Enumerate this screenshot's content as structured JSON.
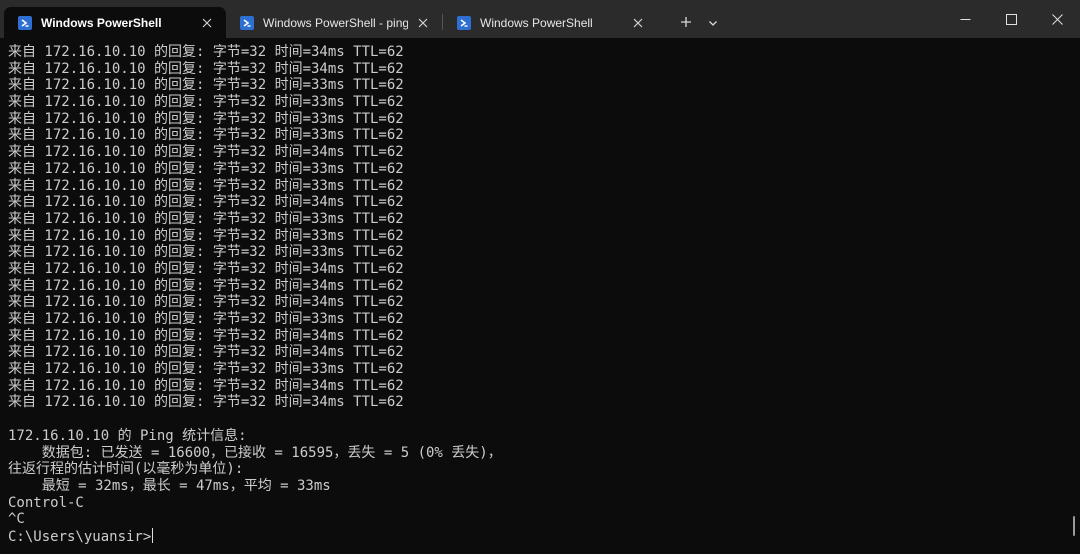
{
  "tabs": [
    {
      "title": "Windows PowerShell",
      "active": true
    },
    {
      "title": "Windows PowerShell - ping  ikt",
      "active": false
    },
    {
      "title": "Windows PowerShell",
      "active": false
    }
  ],
  "icons": {
    "tab_icon": "powershell-icon",
    "tab_close": "close-icon",
    "new_tab": "plus-icon",
    "dropdown": "chevron-down-icon",
    "minimize": "minimize-icon",
    "maximize": "maximize-icon",
    "close": "close-icon"
  },
  "colors": {
    "titlebar": "#2b2b2b",
    "terminal_bg": "#0c0c0c",
    "terminal_fg": "#cccccc",
    "powershell_icon": "#2d6fd3"
  },
  "terminal": {
    "lines": [
      "来自 172.16.10.10 的回复: 字节=32 时间=34ms TTL=62",
      "来自 172.16.10.10 的回复: 字节=32 时间=34ms TTL=62",
      "来自 172.16.10.10 的回复: 字节=32 时间=33ms TTL=62",
      "来自 172.16.10.10 的回复: 字节=32 时间=33ms TTL=62",
      "来自 172.16.10.10 的回复: 字节=32 时间=33ms TTL=62",
      "来自 172.16.10.10 的回复: 字节=32 时间=33ms TTL=62",
      "来自 172.16.10.10 的回复: 字节=32 时间=34ms TTL=62",
      "来自 172.16.10.10 的回复: 字节=32 时间=33ms TTL=62",
      "来自 172.16.10.10 的回复: 字节=32 时间=33ms TTL=62",
      "来自 172.16.10.10 的回复: 字节=32 时间=34ms TTL=62",
      "来自 172.16.10.10 的回复: 字节=32 时间=33ms TTL=62",
      "来自 172.16.10.10 的回复: 字节=32 时间=33ms TTL=62",
      "来自 172.16.10.10 的回复: 字节=32 时间=33ms TTL=62",
      "来自 172.16.10.10 的回复: 字节=32 时间=34ms TTL=62",
      "来自 172.16.10.10 的回复: 字节=32 时间=34ms TTL=62",
      "来自 172.16.10.10 的回复: 字节=32 时间=34ms TTL=62",
      "来自 172.16.10.10 的回复: 字节=32 时间=33ms TTL=62",
      "来自 172.16.10.10 的回复: 字节=32 时间=34ms TTL=62",
      "来自 172.16.10.10 的回复: 字节=32 时间=34ms TTL=62",
      "来自 172.16.10.10 的回复: 字节=32 时间=33ms TTL=62",
      "来自 172.16.10.10 的回复: 字节=32 时间=34ms TTL=62",
      "来自 172.16.10.10 的回复: 字节=32 时间=34ms TTL=62",
      "",
      "172.16.10.10 的 Ping 统计信息:",
      "    数据包: 已发送 = 16600，已接收 = 16595，丢失 = 5 (0% 丢失)，",
      "往返行程的估计时间(以毫秒为单位):",
      "    最短 = 32ms，最长 = 47ms，平均 = 33ms",
      "Control-C",
      "^C"
    ],
    "prompt": "C:\\Users\\yuansir>"
  }
}
